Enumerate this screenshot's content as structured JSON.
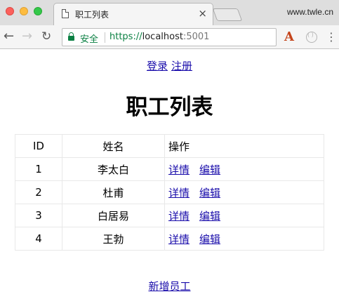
{
  "browser": {
    "tab_title": "职工列表",
    "tab_close": "×",
    "site_brand": "www.twle.cn",
    "secure_label": "安全",
    "url_scheme": "https://",
    "url_host": "localhost",
    "url_port": ":5001",
    "icons": {
      "back": "back-arrow-icon",
      "forward": "forward-arrow-icon",
      "reload": "reload-icon",
      "lock": "lock-icon",
      "extension_a": "font-extension-icon",
      "extension_circle": "extension-circle-icon",
      "menu": "kebab-menu-icon"
    }
  },
  "auth": {
    "login": "登录",
    "register": "注册"
  },
  "page_title": "职工列表",
  "table": {
    "headers": {
      "id": "ID",
      "name": "姓名",
      "ops": "操作"
    },
    "rows": [
      {
        "id": "1",
        "name": "李太白",
        "detail": "详情",
        "edit": "编辑"
      },
      {
        "id": "2",
        "name": "杜甫",
        "detail": "详情",
        "edit": "编辑"
      },
      {
        "id": "3",
        "name": "白居易",
        "detail": "详情",
        "edit": "编辑"
      },
      {
        "id": "4",
        "name": "王勃",
        "detail": "详情",
        "edit": "编辑"
      }
    ]
  },
  "add_employee": "新增员工",
  "colors": {
    "link": "#1a0dab",
    "secure_green": "#0b8043",
    "tabbar_bg": "#dedede",
    "toolbar_bg": "#f5f5f5"
  }
}
